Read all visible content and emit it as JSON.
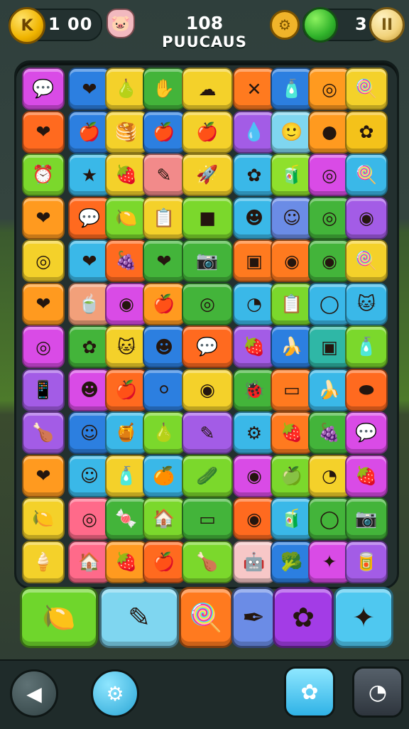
{
  "header": {
    "coin_icon_label": "K",
    "coins": "1 00",
    "level_number": "108",
    "level_title": "PUUCAUS",
    "moves": "3",
    "pause_label": "II"
  },
  "board": {
    "rows": [
      [
        {
          "c": "#d94be6",
          "g": "💬"
        },
        {
          "c": "#2c7fe0",
          "g": "❤"
        },
        {
          "c": "#f4d12a",
          "g": "🍐"
        },
        {
          "c": "#43b43a",
          "g": "✋"
        },
        {
          "c": "#f4d12a",
          "g": "☁",
          "w": 1
        },
        {
          "c": "#ff7a1f",
          "g": "✕"
        },
        {
          "c": "#2c7fe0",
          "g": "🧴"
        },
        {
          "c": "#ff9a1f",
          "g": "◎"
        },
        {
          "c": "#f4d12a",
          "g": "🍭"
        }
      ],
      [
        {
          "c": "#ff6a1f",
          "g": "❤"
        },
        {
          "c": "#2c7fe0",
          "g": "🍎"
        },
        {
          "c": "#f4d12a",
          "g": "🥞"
        },
        {
          "c": "#2c7fe0",
          "g": "🍎"
        },
        {
          "c": "#f4d12a",
          "g": "🍎",
          "w": 1
        },
        {
          "c": "#a35ce6",
          "g": "💧"
        },
        {
          "c": "#7fd6f0",
          "g": "🙂"
        },
        {
          "c": "#ff9a1f",
          "g": "●"
        },
        {
          "c": "#f4c21a",
          "g": "✿"
        }
      ],
      [
        {
          "c": "#7bd82c",
          "g": "⏰"
        },
        {
          "c": "#3ab8e8",
          "g": "★"
        },
        {
          "c": "#f4d12a",
          "g": "🍓"
        },
        {
          "c": "#f28a8a",
          "g": "✎"
        },
        {
          "c": "#f4d12a",
          "g": "🚀",
          "w": 1
        },
        {
          "c": "#3ab8e8",
          "g": "✿"
        },
        {
          "c": "#8fe02c",
          "g": "🧃"
        },
        {
          "c": "#d94be6",
          "g": "◎"
        },
        {
          "c": "#3ab8e8",
          "g": "🍭"
        }
      ],
      [
        {
          "c": "#ff9a1f",
          "g": "❤"
        },
        {
          "c": "#ff6a1f",
          "g": "💬"
        },
        {
          "c": "#7bd82c",
          "g": "🍋"
        },
        {
          "c": "#f4d12a",
          "g": "📋"
        },
        {
          "c": "#7bd82c",
          "g": "■",
          "w": 1
        },
        {
          "c": "#3ab8e8",
          "g": "☻"
        },
        {
          "c": "#6b8ce6",
          "g": "☺"
        },
        {
          "c": "#43b43a",
          "g": "◎"
        },
        {
          "c": "#a35ce6",
          "g": "◉"
        }
      ],
      [
        {
          "c": "#f4d12a",
          "g": "◎"
        },
        {
          "c": "#3ab8e8",
          "g": "❤"
        },
        {
          "c": "#ff6a1f",
          "g": "🍇"
        },
        {
          "c": "#43b43a",
          "g": "❤"
        },
        {
          "c": "#43b43a",
          "g": "📷",
          "w": 1
        },
        {
          "c": "#ff7a1f",
          "g": "▣"
        },
        {
          "c": "#ff7a1f",
          "g": "◉"
        },
        {
          "c": "#43b43a",
          "g": "◉"
        },
        {
          "c": "#f4d12a",
          "g": "🍭"
        }
      ],
      [
        {
          "c": "#ff9a1f",
          "g": "❤"
        },
        {
          "c": "#f2a07a",
          "g": "🍵"
        },
        {
          "c": "#d94be6",
          "g": "◉"
        },
        {
          "c": "#ff9a1f",
          "g": "🍎"
        },
        {
          "c": "#43b43a",
          "g": "◎",
          "w": 1
        },
        {
          "c": "#3ab8e8",
          "g": "◔"
        },
        {
          "c": "#7bd82c",
          "g": "📋"
        },
        {
          "c": "#3ab8e8",
          "g": "◯"
        },
        {
          "c": "#3ab8e8",
          "g": "🐱"
        }
      ],
      [
        {
          "c": "#d94be6",
          "g": "◎"
        },
        {
          "c": "#43b43a",
          "g": "✿"
        },
        {
          "c": "#f4d12a",
          "g": "🐱"
        },
        {
          "c": "#2c7fe0",
          "g": "☻"
        },
        {
          "c": "#ff6a1f",
          "g": "💬",
          "w": 1
        },
        {
          "c": "#a35ce6",
          "g": "🍓"
        },
        {
          "c": "#2c7fe0",
          "g": "🍌"
        },
        {
          "c": "#2fb7a6",
          "g": "▣"
        },
        {
          "c": "#7bd82c",
          "g": "🧴"
        }
      ],
      [
        {
          "c": "#a35ce6",
          "g": "📱"
        },
        {
          "c": "#d94be6",
          "g": "☻"
        },
        {
          "c": "#ff6a1f",
          "g": "🍎"
        },
        {
          "c": "#2c7fe0",
          "g": "⚪"
        },
        {
          "c": "#f4d12a",
          "g": "◉",
          "w": 1
        },
        {
          "c": "#43b43a",
          "g": "🐞"
        },
        {
          "c": "#ff7a1f",
          "g": "▭"
        },
        {
          "c": "#3ab8e8",
          "g": "🍌"
        },
        {
          "c": "#ff6a1f",
          "g": "⬬"
        }
      ],
      [
        {
          "c": "#a35ce6",
          "g": "🍗"
        },
        {
          "c": "#2c7fe0",
          "g": "☺"
        },
        {
          "c": "#3ab8e8",
          "g": "🍯"
        },
        {
          "c": "#7bd82c",
          "g": "🍐"
        },
        {
          "c": "#a35ce6",
          "g": "✎",
          "w": 1
        },
        {
          "c": "#3ab8e8",
          "g": "⚙"
        },
        {
          "c": "#ff7a1f",
          "g": "🍓"
        },
        {
          "c": "#43b43a",
          "g": "🍇"
        },
        {
          "c": "#d94be6",
          "g": "💬"
        }
      ],
      [
        {
          "c": "#ff9a1f",
          "g": "❤"
        },
        {
          "c": "#3ab8e8",
          "g": "☺"
        },
        {
          "c": "#f4d12a",
          "g": "🧴"
        },
        {
          "c": "#3ab8e8",
          "g": "🍊"
        },
        {
          "c": "#7bd82c",
          "g": "🥒",
          "w": 1
        },
        {
          "c": "#d94be6",
          "g": "◉"
        },
        {
          "c": "#7bd82c",
          "g": "🍏"
        },
        {
          "c": "#f4d12a",
          "g": "◔"
        },
        {
          "c": "#d94be6",
          "g": "🍓"
        }
      ],
      [
        {
          "c": "#f4d12a",
          "g": "🍋"
        },
        {
          "c": "#ff6a8a",
          "g": "◎"
        },
        {
          "c": "#43b43a",
          "g": "🍬"
        },
        {
          "c": "#7bd82c",
          "g": "🏠"
        },
        {
          "c": "#43b43a",
          "g": "▭",
          "w": 1
        },
        {
          "c": "#ff6a1f",
          "g": "◉"
        },
        {
          "c": "#3ab8e8",
          "g": "🧃"
        },
        {
          "c": "#43b43a",
          "g": "◯"
        },
        {
          "c": "#43b43a",
          "g": "📷"
        }
      ],
      [
        {
          "c": "#f4d12a",
          "g": "🍦"
        },
        {
          "c": "#ff6a8a",
          "g": "🏠"
        },
        {
          "c": "#ff9a1f",
          "g": "🍓"
        },
        {
          "c": "#ff6a1f",
          "g": "🍎"
        },
        {
          "c": "#7bd82c",
          "g": "🍗",
          "w": 1
        },
        {
          "c": "#f7c7c7",
          "g": "🤖"
        },
        {
          "c": "#2c7fe0",
          "g": "🥦"
        },
        {
          "c": "#d94be6",
          "g": "✦"
        },
        {
          "c": "#a35ce6",
          "g": "🥫"
        }
      ]
    ]
  },
  "tray": [
    {
      "c": "#6fd62c",
      "g": "🍋"
    },
    {
      "c": "#7fd6f0",
      "g": "✎"
    },
    {
      "c": "#ff7a1f",
      "g": "🍭"
    },
    {
      "c": "#6b8ce6",
      "g": "✒"
    },
    {
      "c": "#a33ce6",
      "g": "✿"
    },
    {
      "c": "#4fc8f0",
      "g": "✦"
    }
  ],
  "bottom": {
    "back_icon": "back-icon",
    "settings_icon": "gear-icon",
    "flower_icon": "flower-icon",
    "camera_icon": "camera-icon"
  }
}
